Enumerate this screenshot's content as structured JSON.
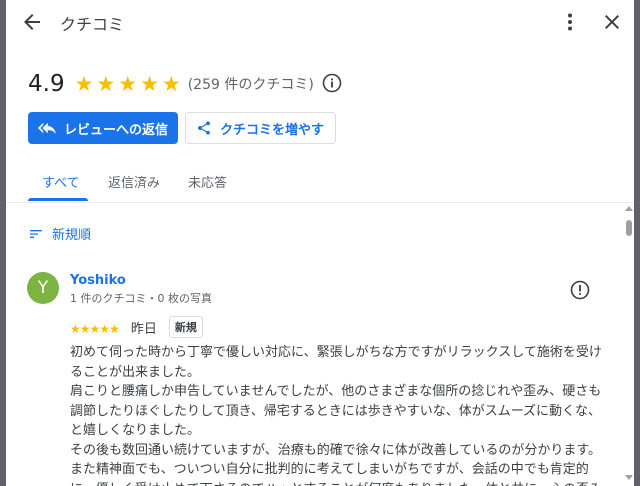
{
  "header": {
    "title": "クチコミ"
  },
  "summary": {
    "rating": "4.9",
    "stars": 5,
    "count_text": "(259 件のクチコミ)"
  },
  "actions": {
    "reply_label": "レビューへの返信",
    "share_label": "クチコミを増やす"
  },
  "tabs": [
    {
      "label": "すべて",
      "active": true
    },
    {
      "label": "返信済み",
      "active": false
    },
    {
      "label": "未応答",
      "active": false
    }
  ],
  "sort": {
    "label": "新規順"
  },
  "review": {
    "avatar_letter": "Y",
    "avatar_color": "#7cb342",
    "name": "Yoshiko",
    "meta": "1 件のクチコミ・0 枚の写真",
    "rating": 5,
    "date": "昨日",
    "badge": "新規",
    "text": "初めて伺った時から丁寧で優しい対応に、緊張しがちな方ですがリラックスして施術を受けることが出来ました。\n肩こりと腰痛しか申告していませんでしたが、他のさまざまな個所の捻じれや歪み、硬さも調節したりほぐしたりして頂き、帰宅するときには歩きやすいな、体がスムーズに動くな、と嬉しくなりました。\nその後も数回通い続けていますが、治療も的確で徐々に体が改善しているのが分かります。\nまた精神面でも、ついつい自分に批判的に考えてしまいがちですが、会話の中でも肯定的に、優しく受け止めて下さるのでハッとすることが何度もありました。体と共に、心の歪み"
  },
  "colors": {
    "accent": "#1a73e8",
    "star": "#fbbc04"
  },
  "icons": [
    "arrow-back-icon",
    "more-vert-icon",
    "close-icon",
    "info-icon",
    "reply-icon",
    "share-icon",
    "sort-icon",
    "flag-icon"
  ]
}
